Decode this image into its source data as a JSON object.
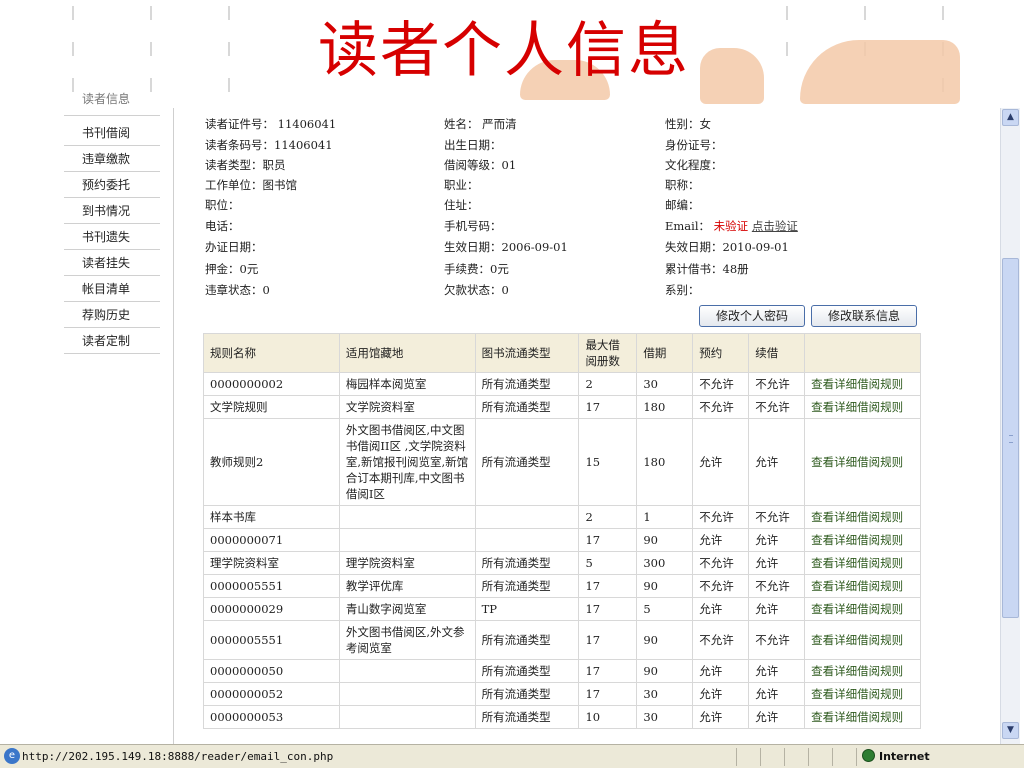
{
  "slide": {
    "title": "读者个人信息"
  },
  "sidebar": {
    "partial_item": "读者信息",
    "items": [
      "书刊借阅",
      "违章缴款",
      "预约委托",
      "到书情况",
      "书刊遗失",
      "读者挂失",
      "帐目清单",
      "荐购历史",
      "读者定制"
    ]
  },
  "reader": {
    "col1": [
      "读者证件号： 11406041",
      "读者条码号：11406041",
      "读者类型：职员",
      "工作单位：图书馆",
      "职位：",
      "电话：",
      "办证日期：",
      "押金：0元",
      "违章状态：0"
    ],
    "col2": [
      "姓名： 严而清",
      "出生日期：",
      "借阅等级：01",
      "职业：",
      "住址：",
      "手机号码：",
      "生效日期：2006-09-01",
      "手续费：0元",
      "欠款状态：0"
    ],
    "col3": [
      "性别：女",
      "身份证号：",
      "文化程度：",
      "职称：",
      "邮编：",
      "Email：",
      "失效日期：2010-09-01",
      "累计借书：48册",
      "系别："
    ],
    "email_status": "未验证",
    "email_verify_link": "点击验证"
  },
  "buttons": {
    "change_password": "修改个人密码",
    "change_contact": "修改联系信息"
  },
  "table": {
    "headers": [
      "规则名称",
      "适用馆藏地",
      "图书流通类型",
      "最大借阅册数",
      "借期",
      "预约",
      "续借",
      ""
    ],
    "rows": [
      [
        "0000000002",
        "梅园样本阅览室",
        "所有流通类型",
        "2",
        "30",
        "不允许",
        "不允许",
        "查看详细借阅规则"
      ],
      [
        "文学院规则",
        "文学院资料室",
        "所有流通类型",
        "17",
        "180",
        "不允许",
        "不允许",
        "查看详细借阅规则"
      ],
      [
        "教师规则2",
        "外文图书借阅区,中文图书借阅II区 ,文学院资料室,新馆报刊阅览室,新馆合订本期刊库,中文图书借阅I区",
        "所有流通类型",
        "15",
        "180",
        "允许",
        "允许",
        "查看详细借阅规则"
      ],
      [
        "样本书库",
        "",
        "",
        "2",
        "1",
        "不允许",
        "不允许",
        "查看详细借阅规则"
      ],
      [
        "0000000071",
        "",
        "",
        "17",
        "90",
        "允许",
        "允许",
        "查看详细借阅规则"
      ],
      [
        "理学院资料室",
        "理学院资料室",
        "所有流通类型",
        "5",
        "300",
        "不允许",
        "允许",
        "查看详细借阅规则"
      ],
      [
        "0000005551",
        "教学评优库",
        "所有流通类型",
        "17",
        "90",
        "不允许",
        "不允许",
        "查看详细借阅规则"
      ],
      [
        "0000000029",
        "青山数字阅览室",
        "TP",
        "17",
        "5",
        "允许",
        "允许",
        "查看详细借阅规则"
      ],
      [
        "0000005551",
        "外文图书借阅区,外文参考阅览室",
        "所有流通类型",
        "17",
        "90",
        "不允许",
        "不允许",
        "查看详细借阅规则"
      ],
      [
        "0000000050",
        "",
        "所有流通类型",
        "17",
        "90",
        "允许",
        "允许",
        "查看详细借阅规则"
      ],
      [
        "0000000052",
        "",
        "所有流通类型",
        "17",
        "30",
        "允许",
        "允许",
        "查看详细借阅规则"
      ],
      [
        "0000000053",
        "",
        "所有流通类型",
        "10",
        "30",
        "允许",
        "允许",
        "查看详细借阅规则"
      ]
    ]
  },
  "statusbar": {
    "url": "http://202.195.149.18:8888/reader/email_con.php",
    "zone": "Internet"
  },
  "scrollbar": {
    "up": "▲",
    "down": "▼"
  },
  "colors": {
    "title": "#d60000",
    "email_status": "#d60000",
    "table_header": "#f3eedb",
    "link": "#2e5a1e"
  }
}
